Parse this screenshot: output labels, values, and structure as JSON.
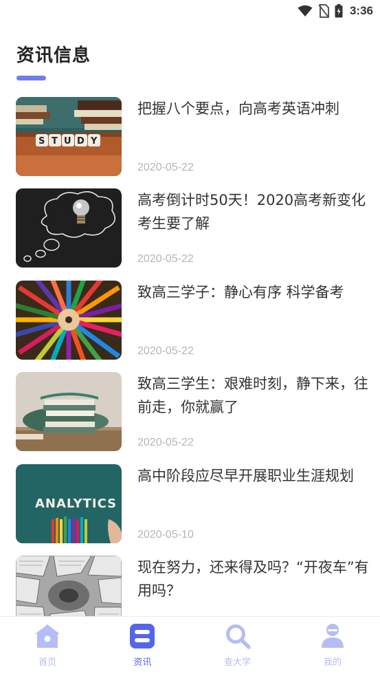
{
  "status_bar": {
    "time": "3:36",
    "icons": [
      "wifi-icon",
      "no-sim-icon",
      "battery-charging-icon"
    ]
  },
  "page": {
    "title": "资讯信息",
    "accent_color": "#6f7cf2"
  },
  "news": [
    {
      "title": "把握八个要点，向高考英语冲刺",
      "date": "2020-05-22",
      "thumbnail": "study-dice-image"
    },
    {
      "title": "高考倒计时50天！2020高考新变化考生要了解",
      "date": "2020-05-22",
      "thumbnail": "lightbulb-chalkboard-image"
    },
    {
      "title": "致高三学子：静心有序 科学备考",
      "date": "2020-05-22",
      "thumbnail": "colored-pencils-image"
    },
    {
      "title": "致高三学生：艰难时刻，静下来，往前走，你就赢了",
      "date": "2020-05-22",
      "thumbnail": "stack-of-books-image"
    },
    {
      "title": "高中阶段应尽早开展职业生涯规划",
      "date": "2020-05-10",
      "thumbnail": "analytics-chalkboard-image"
    },
    {
      "title": "现在努力，还来得及吗？“开夜车”有用吗？",
      "date": "",
      "thumbnail": "newspapers-image"
    }
  ],
  "bottom_nav": {
    "items": [
      {
        "label": "首页",
        "icon": "home-icon",
        "active": false
      },
      {
        "label": "资讯",
        "icon": "news-icon",
        "active": true
      },
      {
        "label": "查大学",
        "icon": "search-icon",
        "active": false
      },
      {
        "label": "我的",
        "icon": "user-icon",
        "active": false
      }
    ],
    "active_color": "#5565ea",
    "inactive_color": "#b4bdf6"
  }
}
